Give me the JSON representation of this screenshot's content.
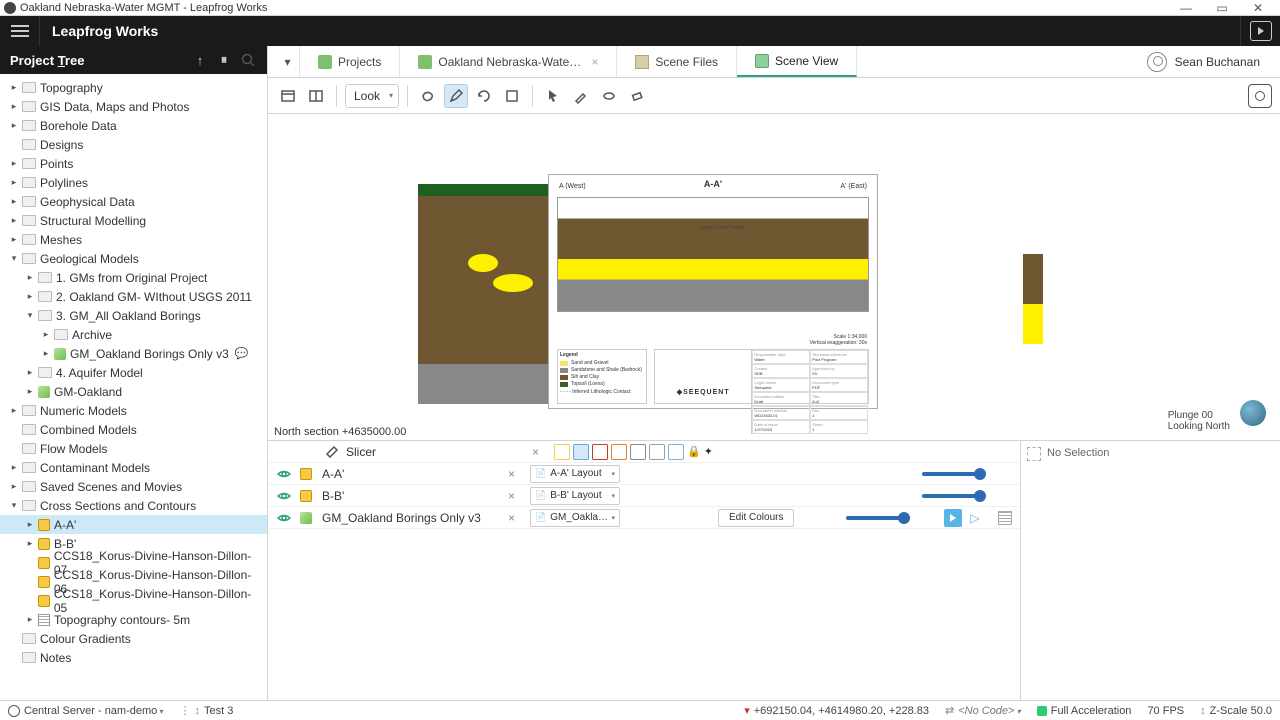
{
  "window_title": "Oakland Nebraska-Water MGMT - Leapfrog Works",
  "app_name": "Leapfrog Works",
  "sidebar_title": "Project Tree",
  "user_name": "Sean Buchanan",
  "tabs": {
    "projects": "Projects",
    "doc": "Oakland Nebraska-Wate…",
    "scene_files": "Scene Files",
    "scene_view": "Scene View"
  },
  "toolbar": {
    "look": "Look"
  },
  "tree": [
    {
      "label": "Topography",
      "depth": 0,
      "exp": "closed",
      "ic": "folder"
    },
    {
      "label": "GIS Data, Maps and Photos",
      "depth": 0,
      "exp": "closed",
      "ic": "folder"
    },
    {
      "label": "Borehole Data",
      "depth": 0,
      "exp": "closed",
      "ic": "folder"
    },
    {
      "label": "Designs",
      "depth": 0,
      "exp": "none",
      "ic": "folder"
    },
    {
      "label": "Points",
      "depth": 0,
      "exp": "closed",
      "ic": "folder"
    },
    {
      "label": "Polylines",
      "depth": 0,
      "exp": "closed",
      "ic": "folder"
    },
    {
      "label": "Geophysical Data",
      "depth": 0,
      "exp": "closed",
      "ic": "folder"
    },
    {
      "label": "Structural Modelling",
      "depth": 0,
      "exp": "closed",
      "ic": "folder"
    },
    {
      "label": "Meshes",
      "depth": 0,
      "exp": "closed",
      "ic": "folder"
    },
    {
      "label": "Geological Models",
      "depth": 0,
      "exp": "open",
      "ic": "folder"
    },
    {
      "label": "1. GMs from Original Project",
      "depth": 1,
      "exp": "closed",
      "ic": "folder"
    },
    {
      "label": "2. Oakland GM- WIthout USGS 2011",
      "depth": 1,
      "exp": "closed",
      "ic": "folder"
    },
    {
      "label": "3. GM_All Oakland Borings",
      "depth": 1,
      "exp": "open",
      "ic": "folder"
    },
    {
      "label": "Archive",
      "depth": 2,
      "exp": "closed",
      "ic": "folder"
    },
    {
      "label": "GM_Oakland Borings Only v3",
      "depth": 2,
      "exp": "closed",
      "ic": "cube",
      "note": true
    },
    {
      "label": "4. Aquifer Model",
      "depth": 1,
      "exp": "closed",
      "ic": "folder"
    },
    {
      "label": "GM-Oakland",
      "depth": 1,
      "exp": "closed",
      "ic": "cube"
    },
    {
      "label": "Numeric Models",
      "depth": 0,
      "exp": "closed",
      "ic": "folder"
    },
    {
      "label": "Combined Models",
      "depth": 0,
      "exp": "none",
      "ic": "folder"
    },
    {
      "label": "Flow Models",
      "depth": 0,
      "exp": "none",
      "ic": "folder"
    },
    {
      "label": "Contaminant Models",
      "depth": 0,
      "exp": "closed",
      "ic": "folder"
    },
    {
      "label": "Saved Scenes and Movies",
      "depth": 0,
      "exp": "closed",
      "ic": "folder"
    },
    {
      "label": "Cross Sections and Contours",
      "depth": 0,
      "exp": "open",
      "ic": "folder"
    },
    {
      "label": "A-A'",
      "depth": 1,
      "exp": "closed",
      "ic": "sec",
      "selected": true
    },
    {
      "label": "B-B'",
      "depth": 1,
      "exp": "closed",
      "ic": "sec"
    },
    {
      "label": "CCS18_Korus-Divine-Hanson-Dillon-07",
      "depth": 1,
      "exp": "none",
      "ic": "sec"
    },
    {
      "label": "CCS18_Korus-Divine-Hanson-Dillon-06",
      "depth": 1,
      "exp": "none",
      "ic": "sec"
    },
    {
      "label": "CCS18_Korus-Divine-Hanson-Dillon-05",
      "depth": 1,
      "exp": "none",
      "ic": "sec"
    },
    {
      "label": "Topography contours- 5m",
      "depth": 1,
      "exp": "closed",
      "ic": "cont"
    },
    {
      "label": "Colour Gradients",
      "depth": 0,
      "exp": "none",
      "ic": "folder"
    },
    {
      "label": "Notes",
      "depth": 0,
      "exp": "none",
      "ic": "folder"
    }
  ],
  "scene": {
    "caption": "North section +4635000.00",
    "plunge": "Plunge 00",
    "looking": "Looking North",
    "section_title": "A-A'",
    "west_label": "A (West)",
    "east_label": "A' (East)",
    "annotation": "Logan Creek Dredge",
    "scale_label": "Scale 1:34,000",
    "exag_label": "Vertical exaggeration: 30x",
    "legend_title": "Legend",
    "legend_items": [
      {
        "label": "Sand and Gravel",
        "color": "#f7e76a"
      },
      {
        "label": "Sandstone and Shale (Bedrock)",
        "color": "#888888"
      },
      {
        "label": "Silt and Clay",
        "color": "#6f5831"
      },
      {
        "label": "Topsoil (Loess)",
        "color": "#3a5f2a"
      }
    ],
    "legend_inferred": "Inferred Lithologic Contact",
    "meta": {
      "brand": "SEEQUENT",
      "resp_dept": "Water",
      "tech_ref": "Pilot Program",
      "creator": "SDB",
      "approved": "SV",
      "legal_owner": "Seequent",
      "doc_type": "PDF",
      "doc_status": "Draft",
      "title": "A-A'",
      "doc_number": "WD23633.01",
      "rev": "1",
      "issue_date": "1/27/2023",
      "sheet": "1"
    }
  },
  "objlist": [
    {
      "name": "Slicer",
      "icon": "slicer",
      "eye": false
    },
    {
      "name": "A-A'",
      "icon": "sec",
      "eye": true,
      "layout": "A-A' Layout"
    },
    {
      "name": "B-B'",
      "icon": "sec",
      "eye": true,
      "layout": "B-B' Layout"
    },
    {
      "name": "GM_Oakland Borings Only v3",
      "icon": "cube",
      "eye": true,
      "layout": "GM_Oakla…",
      "edit": "Edit Colours",
      "play": true
    }
  ],
  "viewbox_icons": [
    "cube-y",
    "cube-b",
    "cube-r",
    "cube-o",
    "cube-g",
    "cube-gray",
    "cube-lb",
    "lock",
    "wand"
  ],
  "selection_panel": "No Selection",
  "status": {
    "server_label": "Central Server - nam-demo",
    "test": "Test 3",
    "coords": "+692150.04, +4614980.20, +228.83",
    "code": "<No Code>",
    "accel": "Full Acceleration",
    "fps": "70 FPS",
    "zscale": "Z-Scale 50.0"
  }
}
